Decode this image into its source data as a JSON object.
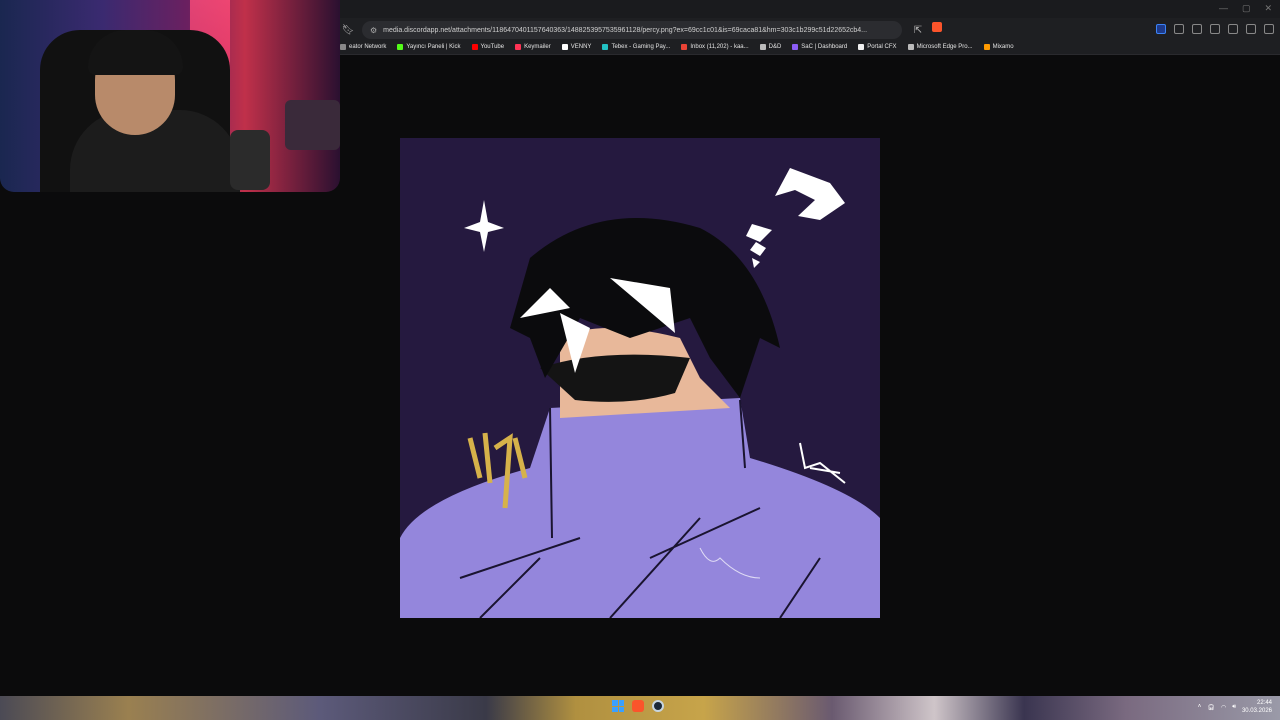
{
  "browser": {
    "url": "media.discordapp.net/attachments/1186470401157640363/1488253957535961128/percy.png?ex=69cc1c01&is=69caca81&hm=303c1b299c51d22652cb4...",
    "bookmarks": [
      {
        "label": "eator Network",
        "color": "#888888"
      },
      {
        "label": "Yayıncı Paneli | Kick",
        "color": "#53fc18"
      },
      {
        "label": "YouTube",
        "color": "#ff0000"
      },
      {
        "label": "Keymailer",
        "color": "#ff3355"
      },
      {
        "label": "VENNY",
        "color": "#ffffff"
      },
      {
        "label": "Tebex - Gaming Pay...",
        "color": "#22c1c3"
      },
      {
        "label": "Inbox (11,202) - kaa...",
        "color": "#ea4335"
      },
      {
        "label": "D&D",
        "color": "#bbbbbb"
      },
      {
        "label": "SaC | Dashboard",
        "color": "#8b5cf6"
      },
      {
        "label": "Portal CFX",
        "color": "#f0f0f0"
      },
      {
        "label": "Microsoft Edge Pro...",
        "color": "#bbbbbb"
      },
      {
        "label": "Mixamo",
        "color": "#ff9a00"
      }
    ]
  },
  "artwork": {
    "background_color": "#25193f",
    "coat_color": "#9486dc"
  },
  "tray": {
    "time": "22:44",
    "date": "30.03.2026"
  }
}
